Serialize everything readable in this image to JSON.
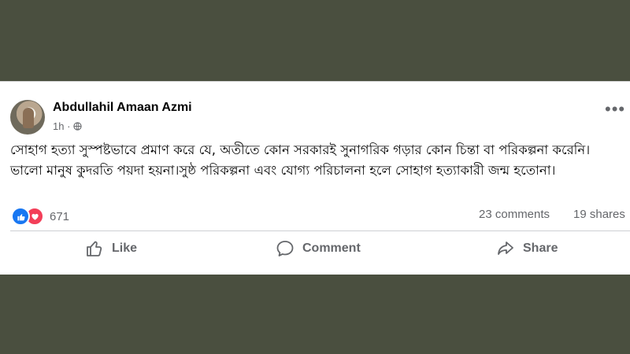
{
  "post": {
    "author": "Abdullahil Amaan Azmi",
    "time": "1h ·",
    "menu_label": "•••",
    "text": "সোহাগ হত্যা সুস্পষ্টভাবে প্রমাণ করে যে, অতীতে কোন সরকারই সুনাগরিক গড়ার কোন চিন্তা বা পরিকল্পনা করেনি। ভালো মানুষ কুদরতি পয়দা হয়না।সুষ্ঠ পরিকল্পনা এবং যোগ্য পরিচালনা হলে সোহাগ হত্যাকারী জন্ম হতোনা।"
  },
  "stats": {
    "reaction_count": "671",
    "comments": "23 comments",
    "shares": "19 shares"
  },
  "actions": {
    "like": "Like",
    "comment": "Comment",
    "share": "Share"
  },
  "icons": {
    "globe": "globe-icon",
    "like_reaction": "thumbs-up-icon",
    "love_reaction": "heart-icon",
    "like": "thumbs-up-outline-icon",
    "comment": "speech-bubble-icon",
    "share": "share-arrow-icon"
  },
  "colors": {
    "background": "#4a4f3f",
    "card": "#ffffff",
    "like_blue": "#1877f2",
    "love_red": "#f33e58",
    "secondary_text": "#65676b"
  }
}
